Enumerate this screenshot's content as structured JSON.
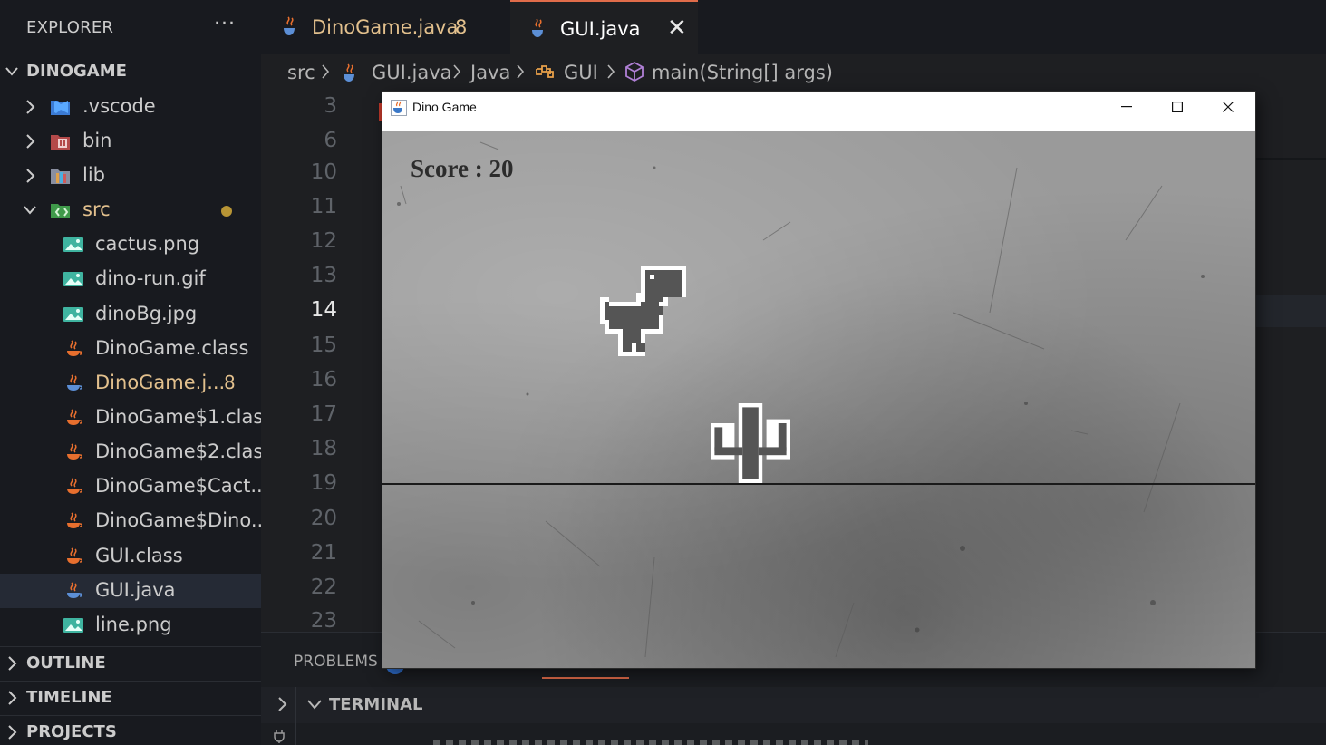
{
  "sidebar": {
    "title": "EXPLORER",
    "more": "···",
    "root": "DINOGAME",
    "items": [
      {
        "name": ".vscode",
        "icon": "vscode-folder-icon"
      },
      {
        "name": "bin",
        "icon": "bin-folder-icon"
      },
      {
        "name": "lib",
        "icon": "lib-folder-icon"
      },
      {
        "name": "src",
        "icon": "src-folder-icon"
      },
      {
        "name": "cactus.png",
        "icon": "image-file-icon"
      },
      {
        "name": "dino-run.gif",
        "icon": "image-file-icon"
      },
      {
        "name": "dinoBg.jpg",
        "icon": "image-file-icon"
      },
      {
        "name": "DinoGame.class",
        "icon": "java-file-icon"
      },
      {
        "name": "DinoGame.j...",
        "icon": "java-file-icon",
        "badge": "8"
      },
      {
        "name": "DinoGame$1.class",
        "icon": "java-file-icon"
      },
      {
        "name": "DinoGame$2.class",
        "icon": "java-file-icon"
      },
      {
        "name": "DinoGame$Cact...",
        "icon": "java-file-icon"
      },
      {
        "name": "DinoGame$Dino...",
        "icon": "java-file-icon"
      },
      {
        "name": "GUI.class",
        "icon": "java-file-icon"
      },
      {
        "name": "GUI.java",
        "icon": "java-file-icon"
      },
      {
        "name": "line.png",
        "icon": "image-file-icon"
      }
    ],
    "sections": {
      "outline": "OUTLINE",
      "timeline": "TIMELINE",
      "projects": "PROJECTS"
    }
  },
  "tabs": [
    {
      "label": "DinoGame.java",
      "badge": "8",
      "active": false
    },
    {
      "label": "GUI.java",
      "close": "✕",
      "active": true
    }
  ],
  "breadcrumb": {
    "src": "src",
    "file": "GUI.java",
    "lang": "Java",
    "class": "GUI",
    "method": "main(String[] args)"
  },
  "gutter": [
    "3",
    "6",
    "10",
    "11",
    "12",
    "13",
    "14",
    "15",
    "16",
    "17",
    "18",
    "19",
    "20",
    "21",
    "22",
    "23"
  ],
  "current_line": "14",
  "panel": {
    "problems": "PROBLEMS",
    "terminal": "TERMINAL"
  },
  "game": {
    "window_title": "Dino Game",
    "score_text": "Score : 20",
    "colors": {
      "title_bar": "#ffffff",
      "background": "#9a9a9a",
      "ground": "#1a1a1a",
      "sprite": "#555555"
    }
  },
  "colors": {
    "modified": "#e2c08d",
    "accent": "#e06c4a",
    "sidebar_bg": "#181a1f",
    "editor_bg": "#1e1f22"
  }
}
